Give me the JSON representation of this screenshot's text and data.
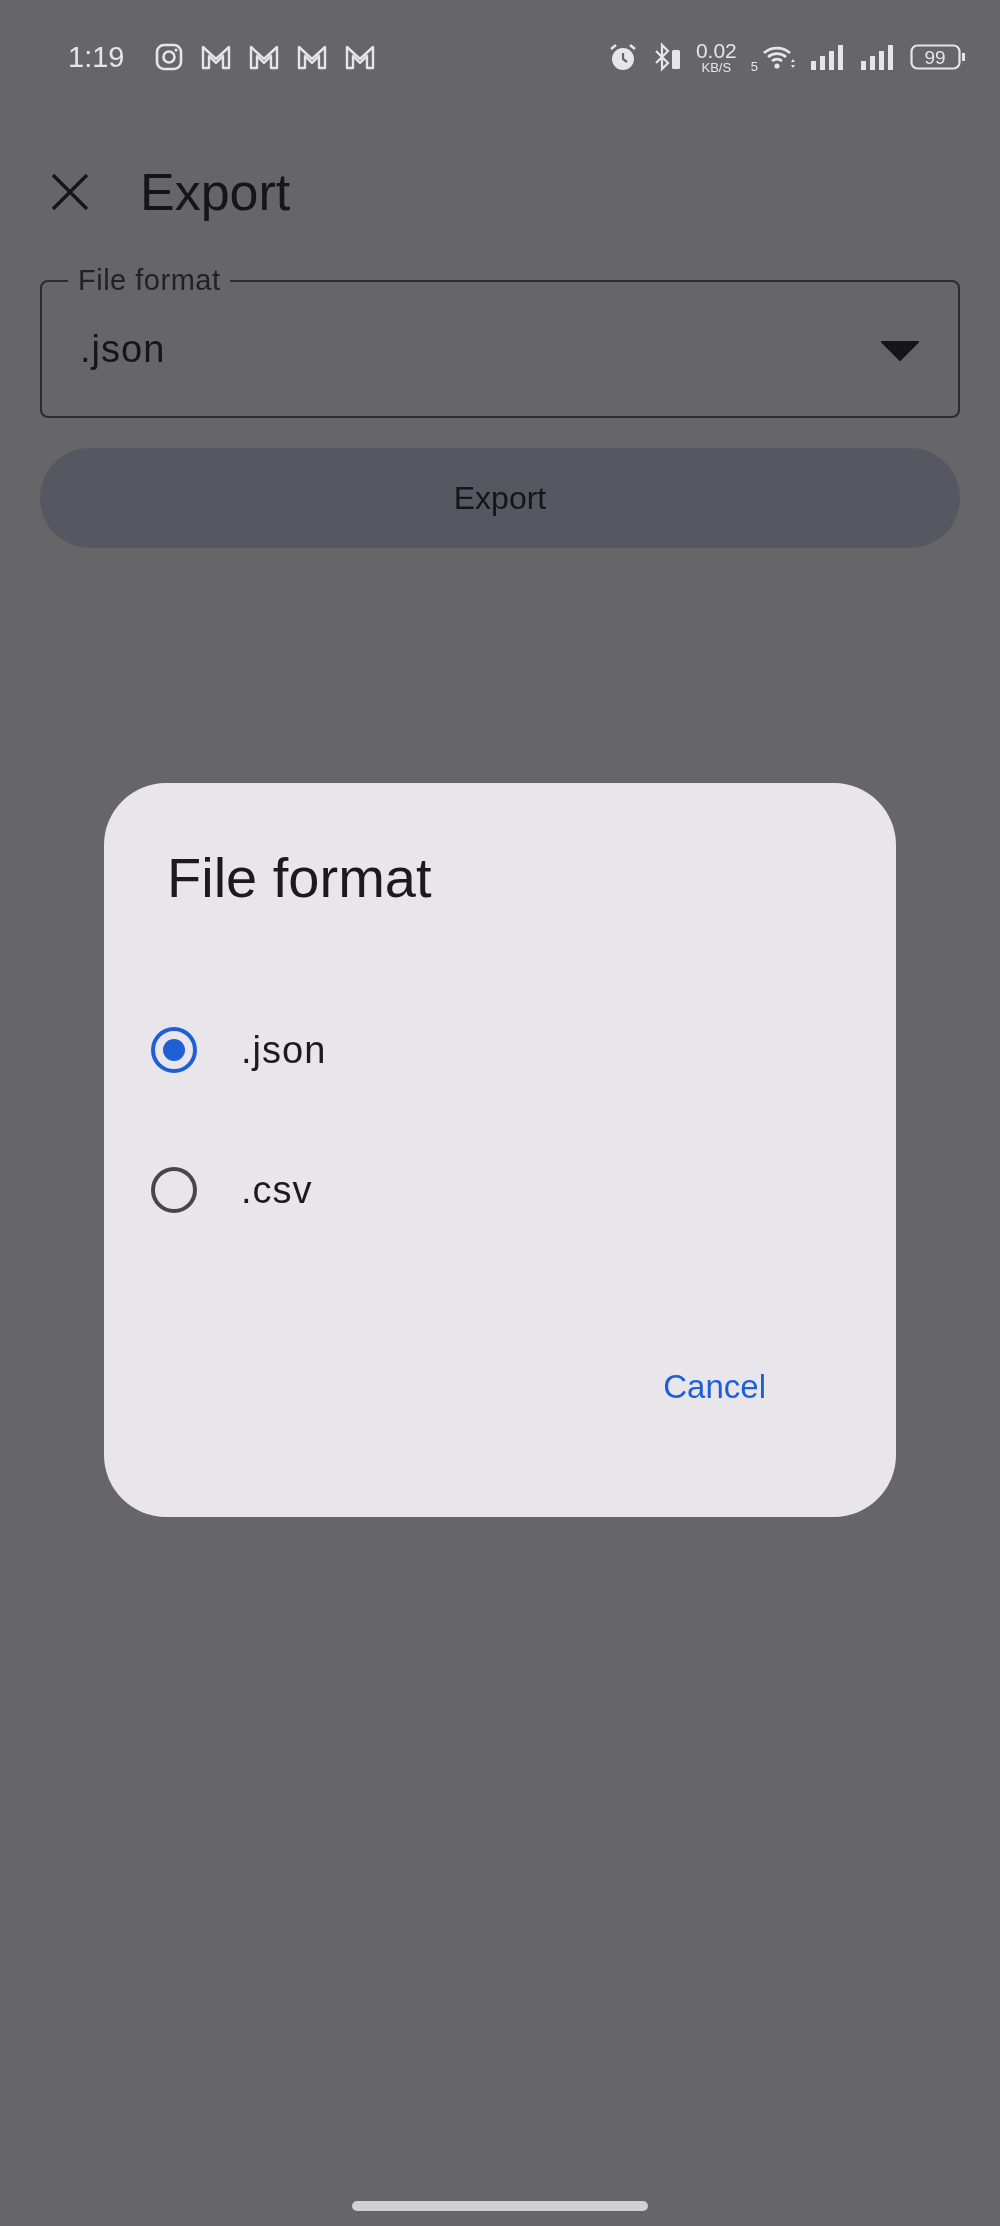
{
  "status_bar": {
    "time": "1:19",
    "network_speed": "0.02",
    "network_speed_unit": "KB/S",
    "wifi_band": "5",
    "battery": "99"
  },
  "header": {
    "title": "Export"
  },
  "format_field": {
    "label": "File format",
    "value": ".json"
  },
  "export_button": {
    "label": "Export"
  },
  "dialog": {
    "title": "File format",
    "options": [
      {
        "label": ".json",
        "selected": true
      },
      {
        "label": ".csv",
        "selected": false
      }
    ],
    "buttons": [
      {
        "label": "Cancel"
      }
    ]
  }
}
